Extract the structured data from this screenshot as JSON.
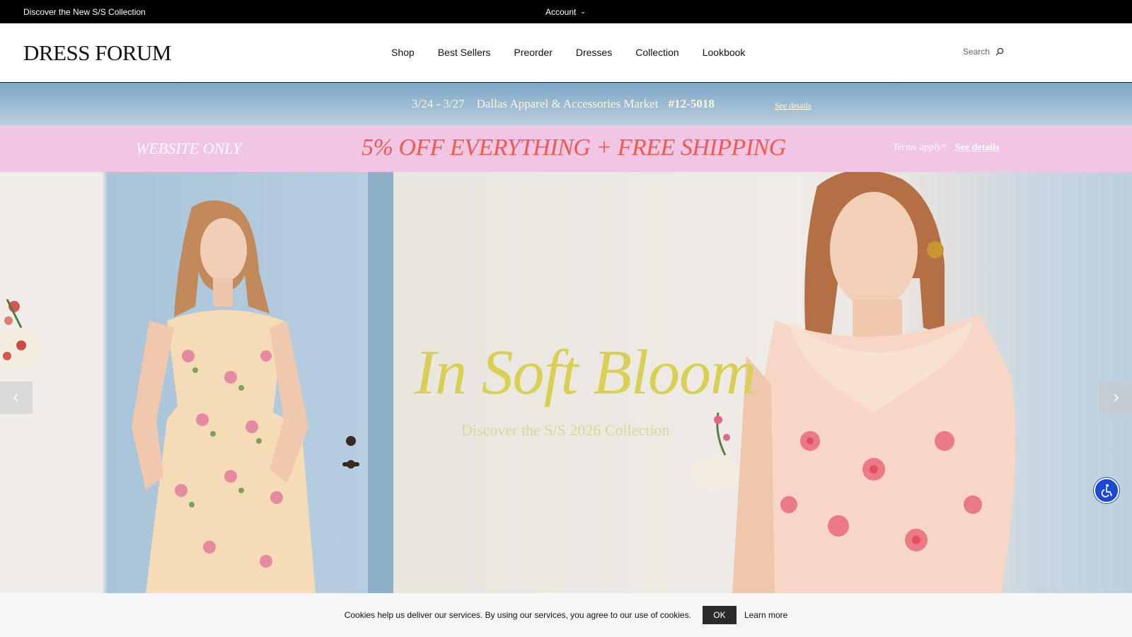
{
  "topbar": {
    "promo": "Discover the New S/S Collection",
    "account": "Account"
  },
  "header": {
    "logo": "DRESS FORUM",
    "nav": [
      "Shop",
      "Best Sellers",
      "Preorder",
      "Dresses",
      "Collection",
      "Lookbook"
    ],
    "search_label": "Search"
  },
  "market_banner": {
    "dates": "3/24 - 3/27",
    "event": "Dallas Apparel & Accessories Market",
    "booth": "#12-5018",
    "link": "See details"
  },
  "promo_banner": {
    "left": "WEBSITE ONLY",
    "deal": "5% OFF EVERYTHING + FREE SHIPPING",
    "terms": "Terms apply*",
    "link": "See details"
  },
  "hero": {
    "title": "In Soft Bloom",
    "subtitle": "Discover the S/S 2026 Collection"
  },
  "cookie": {
    "message": "Cookies help us deliver our services. By using our services, you agree to our use of cookies.",
    "ok": "OK",
    "learn_more": "Learn more"
  },
  "colors": {
    "topbar_bg": "#000000",
    "promo_pink": "#f1c5e4",
    "deal_red": "#ef5a4f",
    "hero_title": "#d9cf52",
    "a11y_blue": "#1b48d6"
  }
}
